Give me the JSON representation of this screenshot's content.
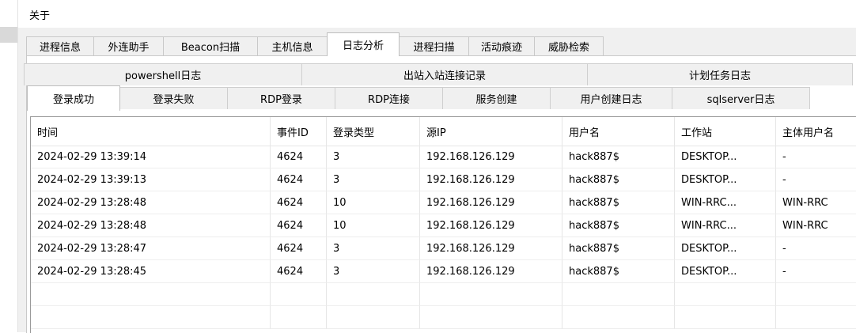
{
  "menu": {
    "about": "关于"
  },
  "main_tabs": [
    {
      "label": "进程信息",
      "width": 96
    },
    {
      "label": "外连助手",
      "width": 88
    },
    {
      "label": "Beacon扫描",
      "width": 118
    },
    {
      "label": "主机信息",
      "width": 88
    },
    {
      "label": "日志分析",
      "width": 96,
      "active": true
    },
    {
      "label": "进程扫描",
      "width": 88
    },
    {
      "label": "活动痕迹",
      "width": 80
    },
    {
      "label": "威胁检索",
      "width": 88
    }
  ],
  "sub_tabs_row1": [
    {
      "label": "powershell日志"
    },
    {
      "label": "出站入站连接记录"
    },
    {
      "label": "计划任务日志"
    }
  ],
  "sub_tabs_row2": [
    {
      "label": "登录成功",
      "active": true
    },
    {
      "label": "登录失败"
    },
    {
      "label": "RDP登录"
    },
    {
      "label": "RDP连接"
    },
    {
      "label": "服务创建"
    },
    {
      "label": "用户创建日志"
    },
    {
      "label": "sqlserver日志"
    }
  ],
  "table": {
    "columns": [
      "时间",
      "事件ID",
      "登录类型",
      "源IP",
      "用户名",
      "工作站",
      "主体用户名"
    ],
    "rows": [
      [
        "2024-02-29 13:39:14",
        "4624",
        "3",
        "192.168.126.129",
        "hack887$",
        "DESKTOP...",
        "-"
      ],
      [
        "2024-02-29 13:39:13",
        "4624",
        "3",
        "192.168.126.129",
        "hack887$",
        "DESKTOP...",
        "-"
      ],
      [
        "2024-02-29 13:28:48",
        "4624",
        "10",
        "192.168.126.129",
        "hack887$",
        "WIN-RRC...",
        "WIN-RRC"
      ],
      [
        "2024-02-29 13:28:48",
        "4624",
        "10",
        "192.168.126.129",
        "hack887$",
        "WIN-RRC...",
        "WIN-RRC"
      ],
      [
        "2024-02-29 13:28:47",
        "4624",
        "3",
        "192.168.126.129",
        "hack887$",
        "DESKTOP...",
        "-"
      ],
      [
        "2024-02-29 13:28:45",
        "4624",
        "3",
        "192.168.126.129",
        "hack887$",
        "DESKTOP...",
        "-"
      ],
      [
        "",
        "",
        "",
        "",
        "",
        "",
        ""
      ],
      [
        "",
        "",
        "",
        "",
        "",
        "",
        ""
      ]
    ]
  }
}
